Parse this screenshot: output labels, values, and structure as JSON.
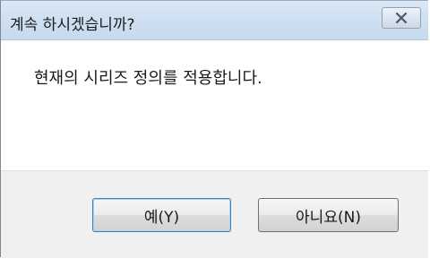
{
  "dialog": {
    "title": "계속 하시겠습니까?",
    "message": "현재의 시리즈 정의를 적용합니다.",
    "buttons": {
      "yes_label": "예(Y)",
      "no_label": "아니요(N)"
    },
    "icons": {
      "close": "close-icon"
    }
  }
}
